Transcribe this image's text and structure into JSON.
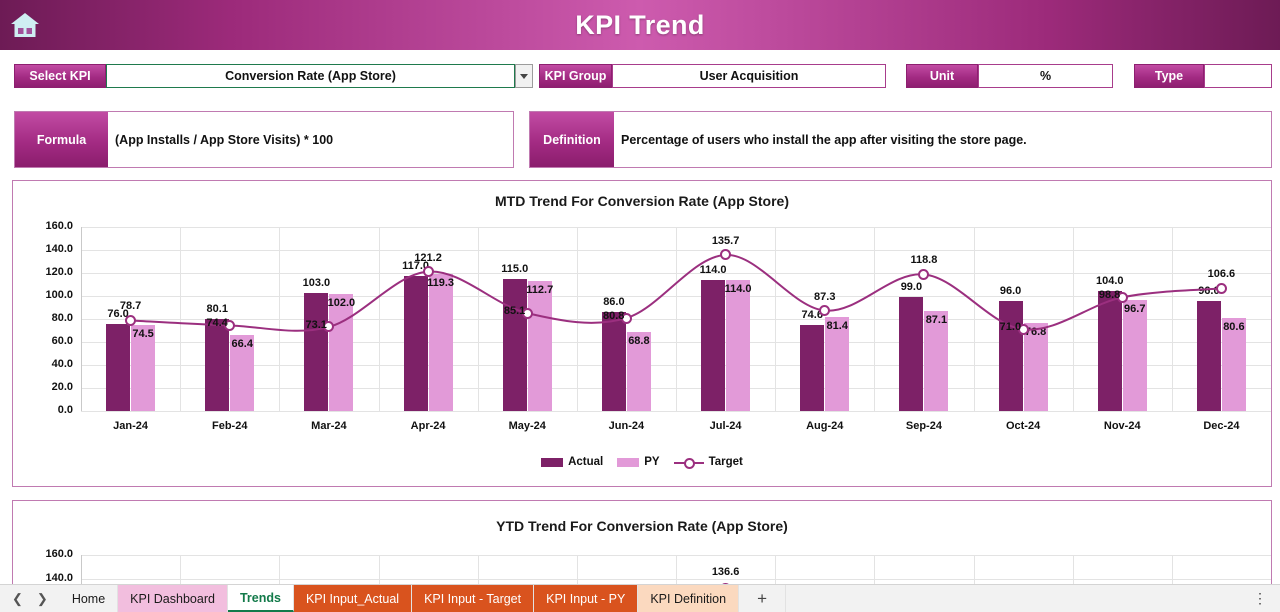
{
  "header": {
    "title": "KPI Trend",
    "home_icon": "home-icon"
  },
  "fields": {
    "select_kpi": {
      "label": "Select KPI",
      "value": "Conversion Rate (App Store)",
      "dropdown_icon": "chevron-down-icon"
    },
    "kpi_group": {
      "label": "KPI Group",
      "value": "User Acquisition"
    },
    "unit": {
      "label": "Unit",
      "value": "%"
    },
    "type": {
      "label": "Type",
      "value": ""
    },
    "formula": {
      "label": "Formula",
      "value": "(App Installs / App Store Visits) * 100"
    },
    "definition": {
      "label": "Definition",
      "value": "Percentage of users who install the app after visiting the store page."
    }
  },
  "chart_data": [
    {
      "id": "mtd",
      "type": "bar",
      "title": "MTD Trend For Conversion Rate (App Store)",
      "xlabel": "",
      "ylabel": "",
      "ylim": [
        0,
        160
      ],
      "yticks": [
        "0.0",
        "20.0",
        "40.0",
        "60.0",
        "80.0",
        "100.0",
        "120.0",
        "140.0",
        "160.0"
      ],
      "grid": true,
      "legend_position": "bottom",
      "categories": [
        "Jan-24",
        "Feb-24",
        "Mar-24",
        "Apr-24",
        "May-24",
        "Jun-24",
        "Jul-24",
        "Aug-24",
        "Sep-24",
        "Oct-24",
        "Nov-24",
        "Dec-24"
      ],
      "series": [
        {
          "name": "Actual",
          "kind": "bar",
          "color": "#7d2167",
          "values": [
            76.0,
            80.1,
            103.0,
            117.0,
            115.0,
            86.0,
            114.0,
            74.6,
            99.0,
            96.0,
            104.0,
            96.0
          ]
        },
        {
          "name": "PY",
          "kind": "bar",
          "color": "#e29ad8",
          "values": [
            74.5,
            66.4,
            102.0,
            119.3,
            112.7,
            68.8,
            114.0,
            81.4,
            87.1,
            76.8,
            96.7,
            80.6
          ]
        },
        {
          "name": "Target",
          "kind": "line",
          "color": "#9b2f7f",
          "values": [
            78.7,
            74.4,
            73.1,
            121.2,
            85.1,
            80.8,
            135.7,
            87.3,
            118.8,
            71.0,
            98.8,
            106.6
          ]
        }
      ]
    },
    {
      "id": "ytd",
      "type": "bar",
      "title": "YTD Trend For Conversion Rate (App Store)",
      "xlabel": "",
      "ylabel": "",
      "ylim": [
        0,
        160
      ],
      "yticks": [
        "140.0",
        "160.0"
      ],
      "grid": true,
      "legend_position": "bottom",
      "categories": [],
      "annotations": [
        "136.6"
      ],
      "series": []
    }
  ],
  "legend": {
    "actual": "Actual",
    "py": "PY",
    "target": "Target"
  },
  "tabbar": {
    "prev_icon": "chevron-left-icon",
    "next_icon": "chevron-right-icon",
    "add_label": "+",
    "kebab_icon": "vertical-dots-icon",
    "tabs": [
      {
        "label": "Home",
        "style": "plain"
      },
      {
        "label": "KPI Dashboard",
        "style": "pink"
      },
      {
        "label": "Trends",
        "style": "active"
      },
      {
        "label": "KPI Input_Actual",
        "style": "orange"
      },
      {
        "label": "KPI Input - Target",
        "style": "orange"
      },
      {
        "label": "KPI Input - PY",
        "style": "orange"
      },
      {
        "label": "KPI Definition",
        "style": "peach"
      }
    ]
  },
  "colors": {
    "brand_magenta": "#a32b83",
    "actual": "#7d2167",
    "py": "#e29ad8",
    "target": "#9b2f7f",
    "panel_border": "#c07ab1"
  }
}
